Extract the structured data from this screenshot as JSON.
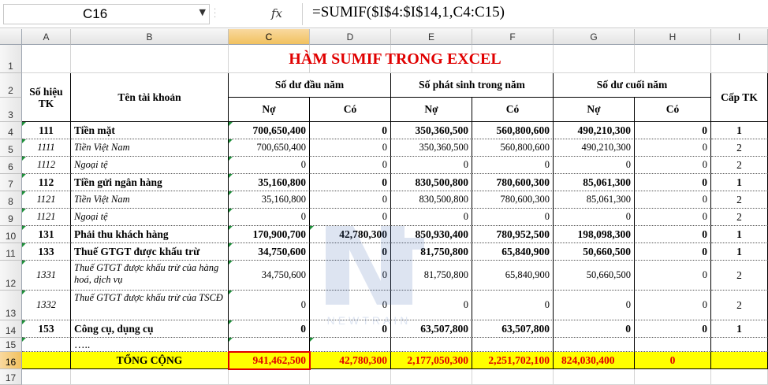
{
  "name_box": {
    "value": "C16"
  },
  "formula_bar": {
    "fx_label": "fx",
    "formula": "=SUMIF($I$4:$I$14,1,C4:C15)"
  },
  "columns": [
    "A",
    "B",
    "C",
    "D",
    "E",
    "F",
    "G",
    "H",
    "I"
  ],
  "rows": [
    "1",
    "2",
    "3",
    "4",
    "5",
    "6",
    "7",
    "8",
    "9",
    "10",
    "11",
    "12",
    "13",
    "14",
    "15",
    "16",
    "17"
  ],
  "sheet": {
    "title": "HÀM SUMIF TRONG EXCEL",
    "headers": {
      "so_hieu": "Số hiệu TK",
      "ten_tk": "Tên tài khoản",
      "dau_nam": "Số dư đầu năm",
      "phat_sinh": "Số phát sinh trong năm",
      "cuoi_nam": "Số dư cuối năm",
      "cap_tk": "Cấp TK",
      "no": "Nợ",
      "co": "Có"
    },
    "data_rows": [
      {
        "code": "111",
        "name": "Tiền mặt",
        "c": "700,650,400",
        "d": "0",
        "e": "350,360,500",
        "f": "560,800,600",
        "g": "490,210,300",
        "h": "0",
        "i": "1"
      },
      {
        "code": "1111",
        "name": "Tiền Việt Nam",
        "c": "700,650,400",
        "d": "0",
        "e": "350,360,500",
        "f": "560,800,600",
        "g": "490,210,300",
        "h": "0",
        "i": "2"
      },
      {
        "code": "1112",
        "name": "Ngoại tệ",
        "c": "0",
        "d": "0",
        "e": "0",
        "f": "0",
        "g": "0",
        "h": "0",
        "i": "2"
      },
      {
        "code": "112",
        "name": "Tiền gửi ngân hàng",
        "c": "35,160,800",
        "d": "0",
        "e": "830,500,800",
        "f": "780,600,300",
        "g": "85,061,300",
        "h": "0",
        "i": "1"
      },
      {
        "code": "1121",
        "name": "Tiền Việt Nam",
        "c": "35,160,800",
        "d": "0",
        "e": "830,500,800",
        "f": "780,600,300",
        "g": "85,061,300",
        "h": "0",
        "i": "2"
      },
      {
        "code": "1121",
        "name": "Ngoại tệ",
        "c": "0",
        "d": "0",
        "e": "0",
        "f": "0",
        "g": "0",
        "h": "0",
        "i": "2"
      },
      {
        "code": "131",
        "name": "Phải thu khách hàng",
        "c": "170,900,700",
        "d": "42,780,300",
        "e": "850,930,400",
        "f": "780,952,500",
        "g": "198,098,300",
        "h": "0",
        "i": "1"
      },
      {
        "code": "133",
        "name": "Thuế GTGT được khấu trừ",
        "c": "34,750,600",
        "d": "0",
        "e": "81,750,800",
        "f": "65,840,900",
        "g": "50,660,500",
        "h": "0",
        "i": "1"
      },
      {
        "code": "1331",
        "name": "Thuế GTGT được khấu trừ của hàng hoá, dịch vụ",
        "c": "34,750,600",
        "d": "0",
        "e": "81,750,800",
        "f": "65,840,900",
        "g": "50,660,500",
        "h": "0",
        "i": "2"
      },
      {
        "code": "1332",
        "name": "Thuế GTGT được khấu trừ của TSCĐ",
        "c": "0",
        "d": "0",
        "e": "0",
        "f": "0",
        "g": "0",
        "h": "0",
        "i": "2"
      },
      {
        "code": "153",
        "name": "Công cụ, dụng cụ",
        "c": "0",
        "d": "0",
        "e": "63,507,800",
        "f": "63,507,800",
        "g": "0",
        "h": "0",
        "i": "1"
      },
      {
        "code": "",
        "name": "…..",
        "c": "",
        "d": "",
        "e": "",
        "f": "",
        "g": "",
        "h": "",
        "i": ""
      }
    ],
    "total": {
      "label": "TỔNG CỘNG",
      "c": "941,462,500",
      "d": "42,780,300",
      "e": "2,177,050,300",
      "f": "2,251,702,100",
      "g": "824,030,400",
      "h": "0"
    }
  },
  "watermark": {
    "text": "NEWTRAIN"
  },
  "colors": {
    "title": "#e00000",
    "total_bg": "#ffff00",
    "selection": "#e00000"
  }
}
